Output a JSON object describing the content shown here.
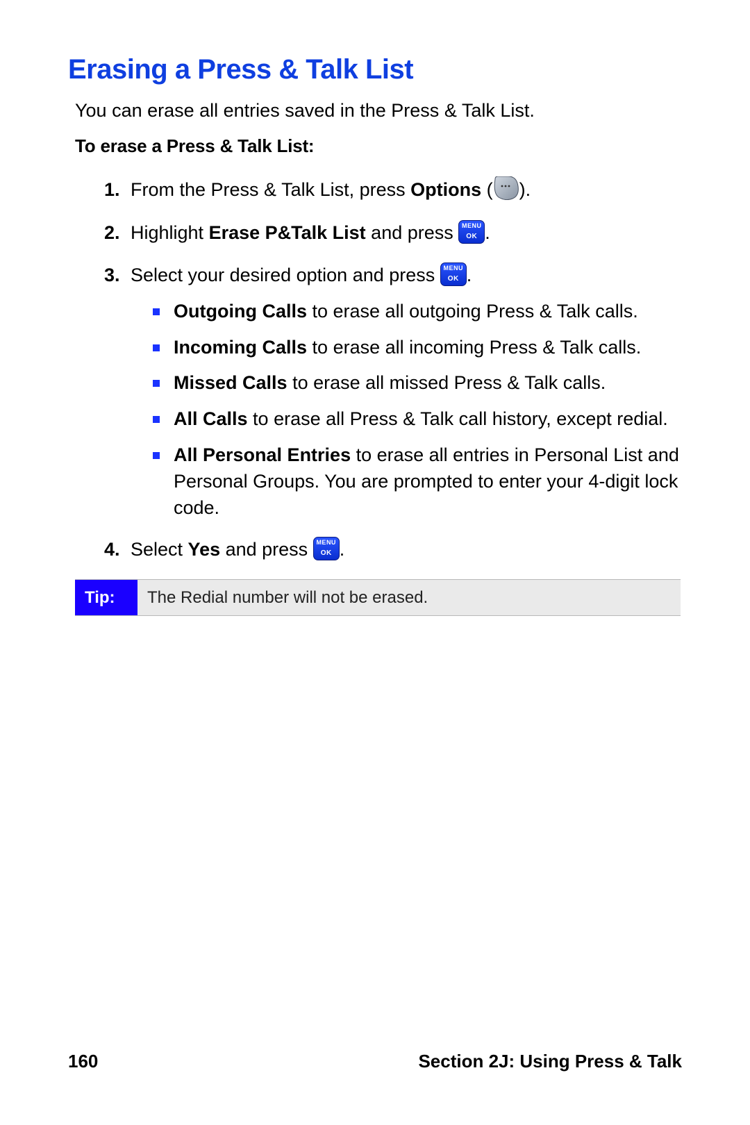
{
  "heading": "Erasing a Press & Talk List",
  "intro": "You can erase all entries saved in the Press & Talk List.",
  "subhead": "To erase a Press & Talk List:",
  "steps": {
    "s1_a": "From the Press & Talk List, press ",
    "s1_b": "Options",
    "s1_c": " (",
    "s1_d": ").",
    "s2_a": "Highlight ",
    "s2_b": "Erase P&Talk List",
    "s2_c": " and press ",
    "s2_d": ".",
    "s3_a": "Select your desired option and press ",
    "s3_b": ".",
    "s4_a": "Select ",
    "s4_b": "Yes",
    "s4_c": " and press ",
    "s4_d": "."
  },
  "sub": {
    "i1_b": "Outgoing Calls",
    "i1_t": " to erase all outgoing Press & Talk calls.",
    "i2_b": "Incoming Calls",
    "i2_t": " to erase all incoming Press & Talk calls.",
    "i3_b": "Missed Calls",
    "i3_t": " to erase all missed Press & Talk calls.",
    "i4_b": "All Calls",
    "i4_t": " to erase all Press & Talk call history, except redial.",
    "i5_b": "All Personal Entries",
    "i5_t": " to erase all entries in Personal List and Personal Groups. You are prompted to enter your 4-digit lock code."
  },
  "tip": {
    "label": "Tip:",
    "body": "The Redial number will not be erased."
  },
  "icons": {
    "menu_top": "MENU",
    "menu_bottom": "OK"
  },
  "footer": {
    "page": "160",
    "section": "Section 2J: Using Press & Talk"
  }
}
